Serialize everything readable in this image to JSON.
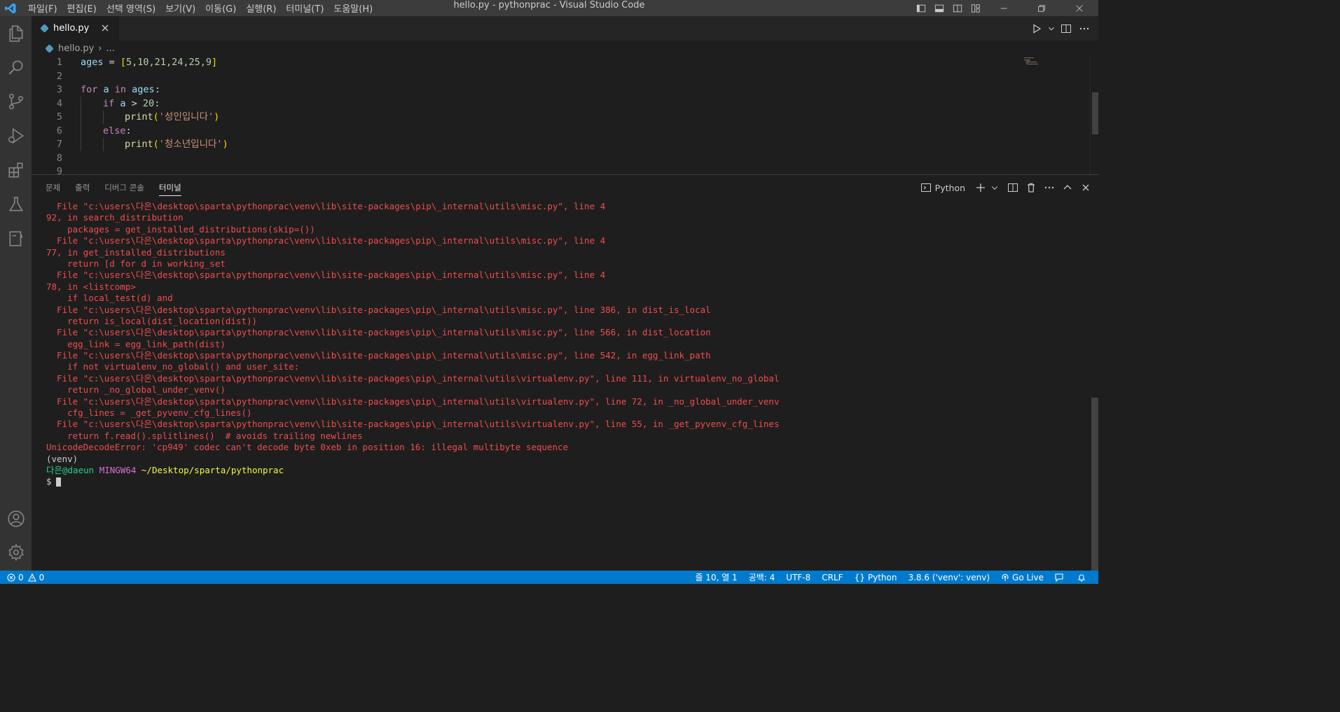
{
  "window": {
    "title": "hello.py - pythonprac - Visual Studio Code",
    "menu": [
      "파일(F)",
      "편집(E)",
      "선택 영역(S)",
      "보기(V)",
      "이동(G)",
      "실행(R)",
      "터미널(T)",
      "도움말(H)"
    ]
  },
  "colors": {
    "accent": "#007acc",
    "error_text": "#f14c4c",
    "prompt_user": "#23d18b",
    "prompt_host": "#d670d6",
    "prompt_path": "#f5f543"
  },
  "activity_bar": [
    "explorer-icon",
    "search-icon",
    "source-control-icon",
    "run-debug-icon",
    "extensions-icon",
    "testing-icon",
    "remote-explorer-icon",
    "account-icon",
    "manage-gear-icon"
  ],
  "tab": {
    "label": "hello.py"
  },
  "breadcrumb": {
    "file": "hello.py",
    "rest": "..."
  },
  "editor": {
    "line_numbers": [
      "1",
      "2",
      "3",
      "4",
      "5",
      "6",
      "7",
      "8",
      "9"
    ],
    "lines": [
      "ages = [5,10,21,24,25,9]",
      "",
      "for a in ages:",
      "    if a > 20:",
      "        print('성인입니다')",
      "    else:",
      "        print('청소년입니다')",
      "",
      ""
    ],
    "tokens": {
      "l1_var": "ages",
      "l1_eq": " = ",
      "l1_open": "[",
      "l1_nums": "5,10,21,24,25,9",
      "l1_close": "]",
      "l3_for": "for",
      "l3_a": " a ",
      "l3_in": "in",
      "l3_ages": " ages",
      "l3_colon": ":",
      "l4_if": "if",
      "l4_a": " a ",
      "l4_gt": "> ",
      "l4_num": "20",
      "l4_colon": ":",
      "l5_print": "print",
      "l5_open": "(",
      "l5_str": "'성인입니다'",
      "l5_close": ")",
      "l6_else": "else",
      "l6_colon": ":",
      "l7_print": "print",
      "l7_open": "(",
      "l7_str": "'청소년입니다'",
      "l7_close": ")"
    }
  },
  "panel": {
    "tabs": [
      "문제",
      "출력",
      "디버그 콘솔",
      "터미널"
    ],
    "active_tab": "터미널",
    "terminal_profile": "Python",
    "terminal_lines": [
      "  File \"c:\\users\\다은\\desktop\\sparta\\pythonprac\\venv\\lib\\site-packages\\pip\\_internal\\utils\\misc.py\", line 4",
      "92, in search_distribution",
      "    packages = get_installed_distributions(skip=())",
      "  File \"c:\\users\\다은\\desktop\\sparta\\pythonprac\\venv\\lib\\site-packages\\pip\\_internal\\utils\\misc.py\", line 4",
      "77, in get_installed_distributions",
      "    return [d for d in working_set",
      "  File \"c:\\users\\다은\\desktop\\sparta\\pythonprac\\venv\\lib\\site-packages\\pip\\_internal\\utils\\misc.py\", line 4",
      "78, in <listcomp>",
      "    if local_test(d) and",
      "  File \"c:\\users\\다은\\desktop\\sparta\\pythonprac\\venv\\lib\\site-packages\\pip\\_internal\\utils\\misc.py\", line 386, in dist_is_local",
      "    return is_local(dist_location(dist))",
      "  File \"c:\\users\\다은\\desktop\\sparta\\pythonprac\\venv\\lib\\site-packages\\pip\\_internal\\utils\\misc.py\", line 566, in dist_location",
      "    egg_link = egg_link_path(dist)",
      "  File \"c:\\users\\다은\\desktop\\sparta\\pythonprac\\venv\\lib\\site-packages\\pip\\_internal\\utils\\misc.py\", line 542, in egg_link_path",
      "    if not virtualenv_no_global() and user_site:",
      "  File \"c:\\users\\다은\\desktop\\sparta\\pythonprac\\venv\\lib\\site-packages\\pip\\_internal\\utils\\virtualenv.py\", line 111, in virtualenv_no_global",
      "    return _no_global_under_venv()",
      "  File \"c:\\users\\다은\\desktop\\sparta\\pythonprac\\venv\\lib\\site-packages\\pip\\_internal\\utils\\virtualenv.py\", line 72, in _no_global_under_venv",
      "    cfg_lines = _get_pyvenv_cfg_lines()",
      "  File \"c:\\users\\다은\\desktop\\sparta\\pythonprac\\venv\\lib\\site-packages\\pip\\_internal\\utils\\virtualenv.py\", line 55, in _get_pyvenv_cfg_lines",
      "    return f.read().splitlines()  # avoids trailing newlines",
      "UnicodeDecodeError: 'cp949' codec can't decode byte 0xeb in position 16: illegal multibyte sequence"
    ],
    "venv_line": "(venv)",
    "prompt_user": "다은@daeun",
    "prompt_host": "MINGW64",
    "prompt_path": "~/Desktop/sparta/pythonprac",
    "prompt_symbol": "$"
  },
  "status": {
    "errors": "0",
    "warnings": "0",
    "position": "줄 10, 열 1",
    "spaces": "공백: 4",
    "encoding": "UTF-8",
    "eol": "CRLF",
    "language": "Python",
    "interpreter": "3.8.6 ('venv': venv)",
    "live": "Go Live"
  }
}
